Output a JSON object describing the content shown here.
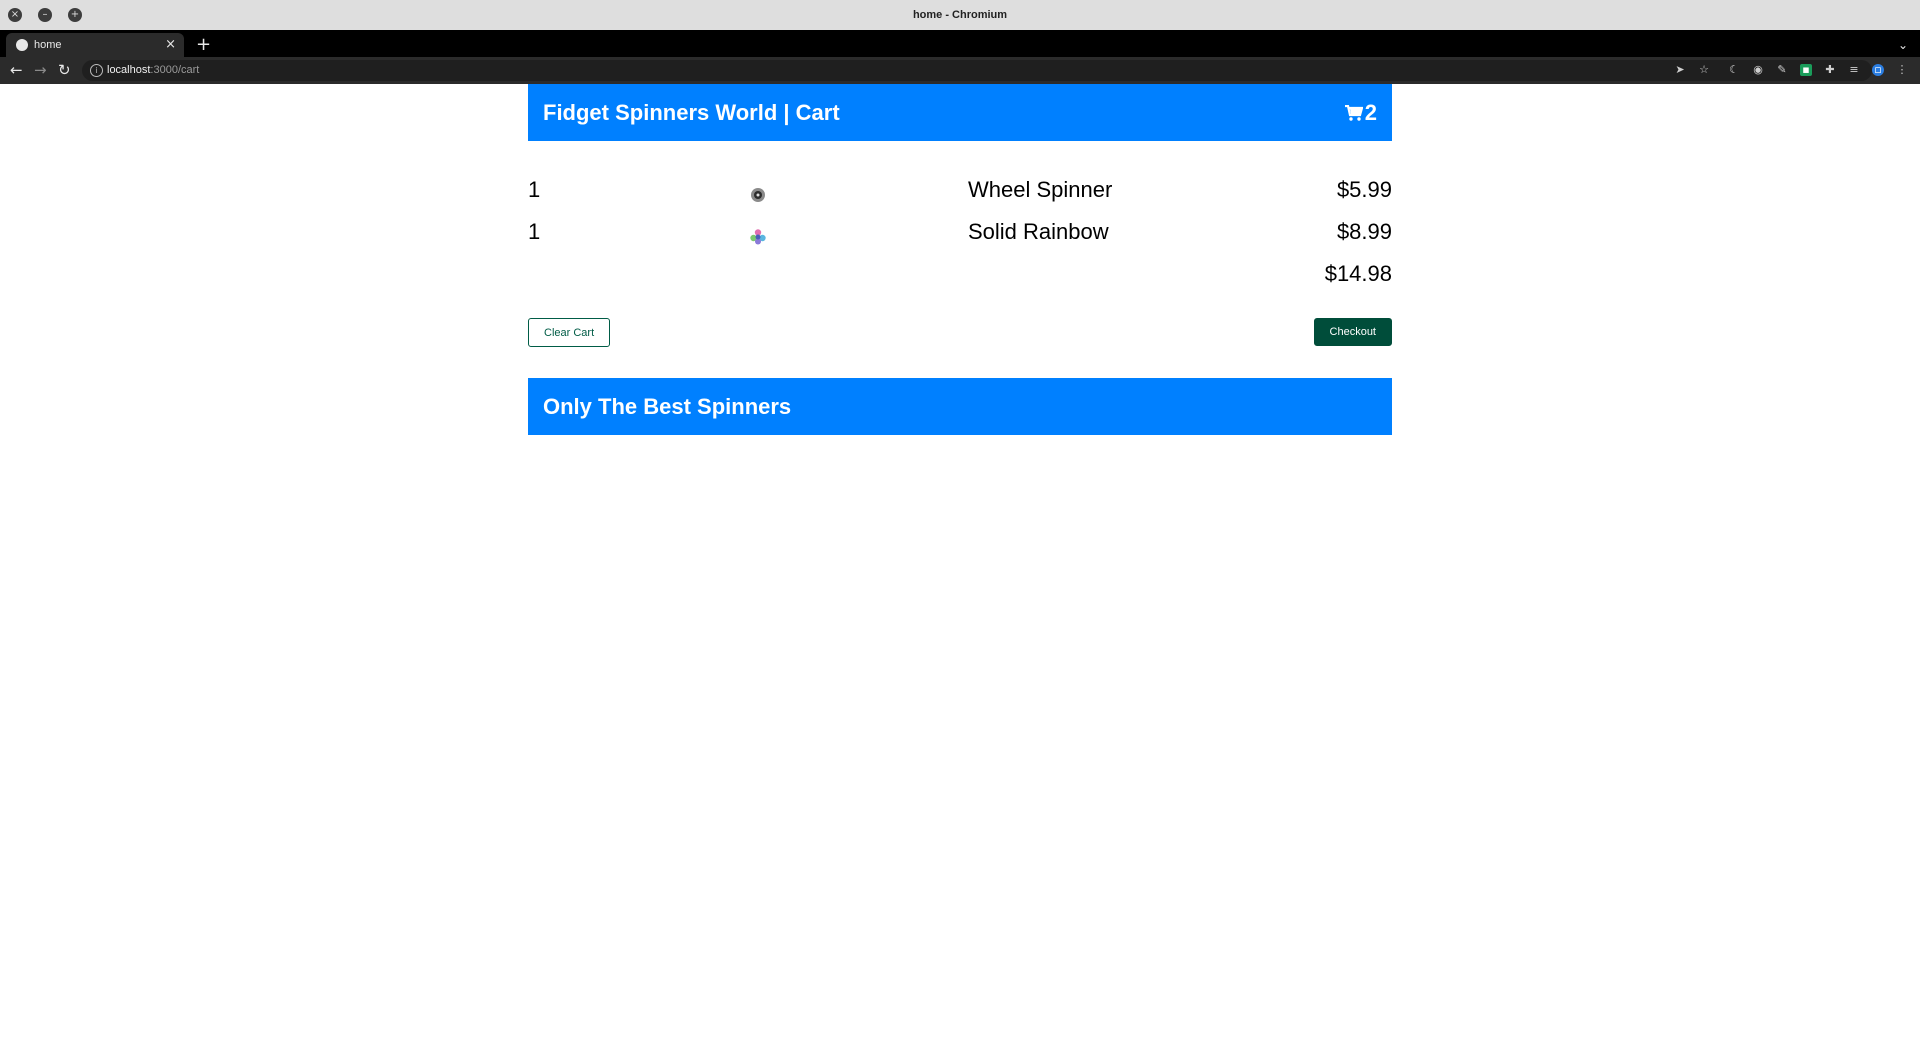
{
  "browser": {
    "window_title": "home - Chromium",
    "tab_title": "home",
    "tab_close": "×",
    "new_tab": "+",
    "url_host": "localhost",
    "url_path": ":3000/cart",
    "controls": {
      "close": "×",
      "minimize": "–",
      "maximize": "+"
    },
    "nav": {
      "back": "←",
      "forward": "→",
      "reload": "↻"
    }
  },
  "header": {
    "title": "Fidget Spinners World | Cart",
    "cart_count": "2"
  },
  "cart": {
    "items": [
      {
        "qty": "1",
        "name": "Wheel Spinner",
        "price": "$5.99",
        "image_color": "#6b6b6b"
      },
      {
        "qty": "1",
        "name": "Solid Rainbow",
        "price": "$8.99",
        "image_color": "#7a8fd0"
      }
    ],
    "total": "$14.98"
  },
  "actions": {
    "clear_label": "Clear Cart",
    "checkout_label": "Checkout"
  },
  "footer": {
    "title": "Only The Best Spinners"
  },
  "colors": {
    "banner": "#0080ff",
    "checkout": "#004d3a",
    "clear_border": "#005c46"
  }
}
